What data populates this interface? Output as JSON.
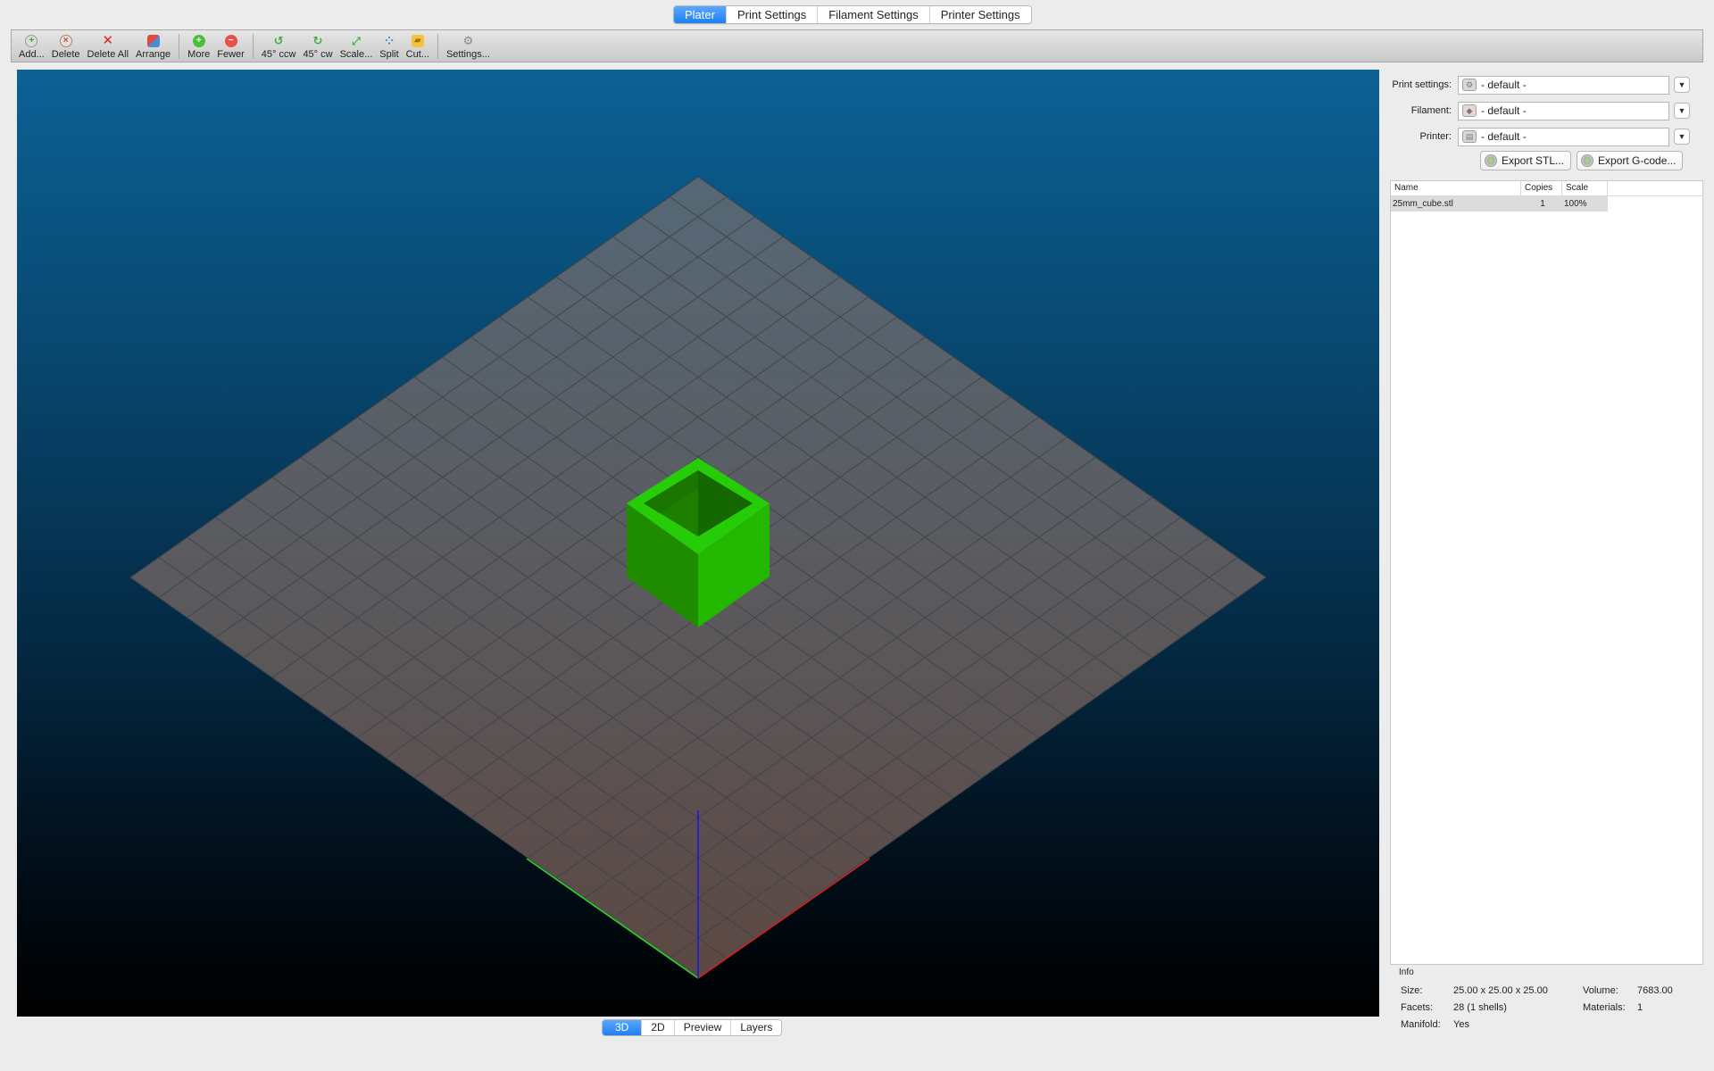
{
  "top_tabs": [
    "Plater",
    "Print Settings",
    "Filament Settings",
    "Printer Settings"
  ],
  "toolbar": {
    "add": "Add...",
    "delete": "Delete",
    "delete_all": "Delete All",
    "arrange": "Arrange",
    "more": "More",
    "fewer": "Fewer",
    "rotate_ccw": "45° ccw",
    "rotate_cw": "45° cw",
    "scale": "Scale...",
    "split": "Split",
    "cut": "Cut...",
    "settings": "Settings..."
  },
  "view_tabs": [
    "3D",
    "2D",
    "Preview",
    "Layers"
  ],
  "presets": {
    "print_label": "Print settings:",
    "print_value": "- default -",
    "filament_label": "Filament:",
    "filament_value": "- default -",
    "printer_label": "Printer:",
    "printer_value": "- default -"
  },
  "export": {
    "stl": "Export STL...",
    "gcode": "Export G-code..."
  },
  "object_list": {
    "headers": [
      "Name",
      "Copies",
      "Scale"
    ],
    "rows": [
      {
        "name": "25mm_cube.stl",
        "copies": "1",
        "scale": "100%"
      }
    ]
  },
  "info": {
    "title": "Info",
    "size_label": "Size:",
    "size_value": "25.00 x 25.00 x 25.00",
    "volume_label": "Volume:",
    "volume_value": "7683.00",
    "facets_label": "Facets:",
    "facets_value": "28 (1 shells)",
    "materials_label": "Materials:",
    "materials_value": "1",
    "manifold_label": "Manifold:",
    "manifold_value": "Yes"
  },
  "icons": {
    "add": "add-icon",
    "delete": "delete-icon",
    "delete_all": "delete-all-icon",
    "arrange": "arrange-icon",
    "more": "plus-icon",
    "fewer": "minus-icon",
    "rotate_ccw": "rotate-ccw-icon",
    "rotate_cw": "rotate-cw-icon",
    "scale": "scale-icon",
    "split": "split-icon",
    "cut": "cut-icon",
    "settings": "gear-icon"
  },
  "colors": {
    "accent": "#1f7ff5",
    "object": "#22c000",
    "axis_x": "#d42020",
    "axis_y": "#27d827",
    "axis_z": "#1a1ad8"
  }
}
